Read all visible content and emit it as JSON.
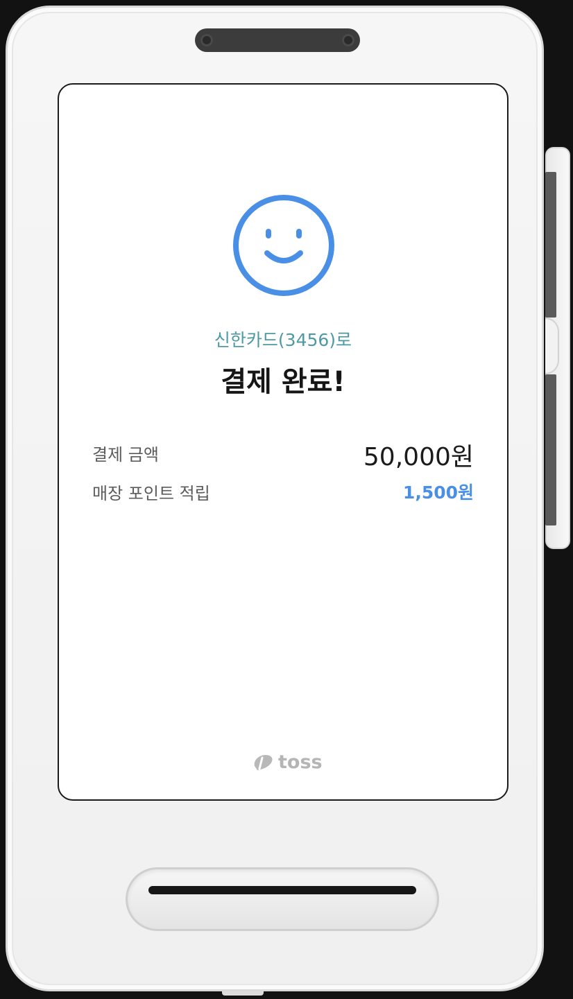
{
  "payment": {
    "card_line": "신한카드(3456)로",
    "title": "결제 완료!",
    "amount_label": "결제  금액",
    "amount_value": "50,000원",
    "points_label": "매장 포인트 적립",
    "points_value": "1,500원"
  },
  "brand": {
    "name": "toss",
    "icon": "toss-logo-icon"
  },
  "icons": {
    "status": "smile-face-icon"
  },
  "colors": {
    "accent_blue": "#4a8fe6",
    "card_text": "#4d9aa4",
    "title_text": "#161616",
    "brand_grey": "#b5b5b5"
  }
}
